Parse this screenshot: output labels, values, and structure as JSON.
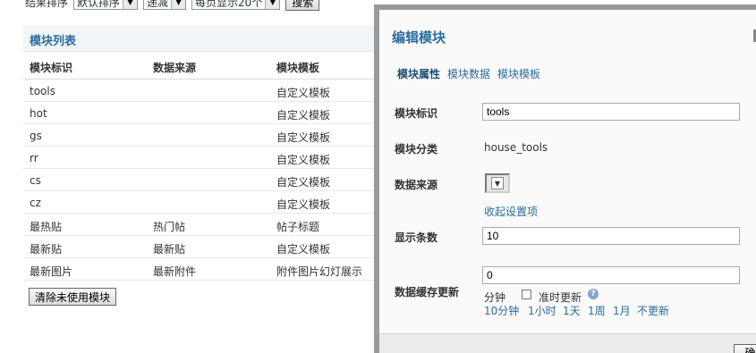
{
  "toolbar": {
    "sort_label": "结果排序",
    "sort_select": "默认排序",
    "order_select": "递减",
    "perpage_select": "每页显示20个",
    "search_button": "搜索"
  },
  "module_list": {
    "title": "模块列表",
    "headers": [
      "模块标识",
      "数据来源",
      "模块模板"
    ],
    "rows": [
      [
        "tools",
        "",
        "自定义模板"
      ],
      [
        "hot",
        "",
        "自定义模板"
      ],
      [
        "gs",
        "",
        "自定义模板"
      ],
      [
        "rr",
        "",
        "自定义模板"
      ],
      [
        "cs",
        "",
        "自定义模板"
      ],
      [
        "cz",
        "",
        "自定义模板"
      ],
      [
        "最热贴",
        "热门帖",
        "帖子标题"
      ],
      [
        "最新贴",
        "最新贴",
        "自定义模板"
      ],
      [
        "最新图片",
        "最新附件",
        "附件图片幻灯展示"
      ]
    ],
    "clear_button": "清除未使用模块"
  },
  "dialog": {
    "title": "编辑模块",
    "tabs": [
      "模块属性",
      "模块数据",
      "模块模板"
    ],
    "fields": {
      "id_label": "模块标识",
      "id_value": "tools",
      "category_label": "模块分类",
      "category_value": "house_tools",
      "source_label": "数据来源",
      "collapse_link": "收起设置项",
      "count_label": "显示条数",
      "count_value": "10",
      "cache_label": "数据缓存更新",
      "cache_value": "0",
      "minute_unit": "分钟",
      "ontime_label": "准时更新",
      "quick_options": [
        "10分钟",
        "1小时",
        "1天",
        "1周",
        "1月",
        "不更新"
      ]
    },
    "confirm_button": "确定"
  }
}
